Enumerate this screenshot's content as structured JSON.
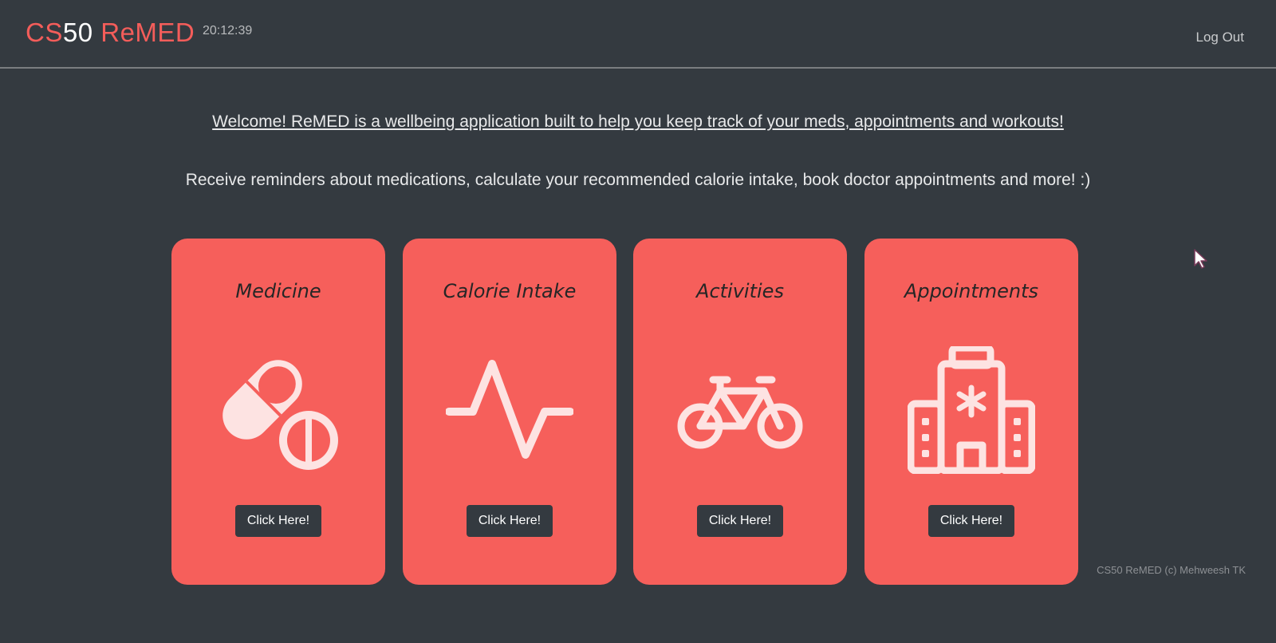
{
  "navbar": {
    "brand_part1": "CS",
    "brand_part2": "50",
    "brand_part3": " ReMED",
    "time": "20:12:39",
    "logout_label": "Log Out"
  },
  "intro": {
    "welcome": "Welcome! ReMED is a wellbeing application built to help you keep track of your meds, appointments and workouts!",
    "description": "Receive reminders about medications, calculate your recommended calorie intake, book doctor appointments and more! :)"
  },
  "cards": [
    {
      "title": "Medicine",
      "icon": "pills-icon",
      "button": "Click Here!"
    },
    {
      "title": "Calorie Intake",
      "icon": "heartbeat-icon",
      "button": "Click Here!"
    },
    {
      "title": "Activities",
      "icon": "bicycle-icon",
      "button": "Click Here!"
    },
    {
      "title": "Appointments",
      "icon": "hospital-icon",
      "button": "Click Here!"
    }
  ],
  "footer": {
    "text": "CS50 ReMED (c) Mehweesh TK"
  },
  "colors": {
    "background": "#343a40",
    "accent": "#f65f5b",
    "icon": "#fde3e2"
  }
}
